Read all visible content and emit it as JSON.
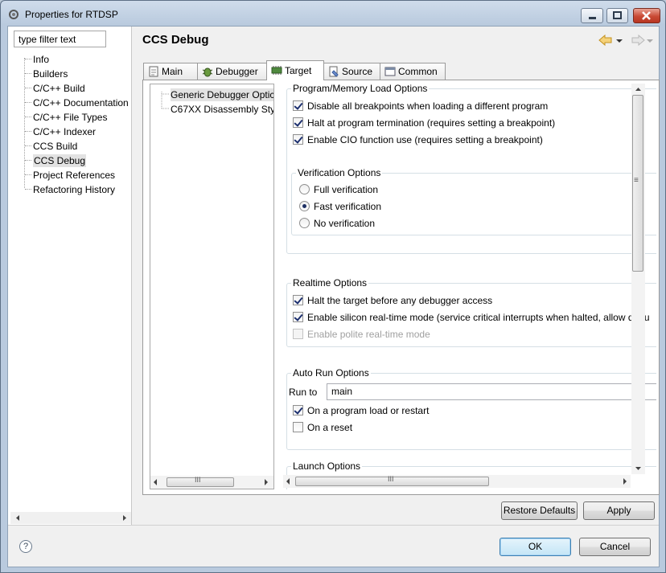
{
  "window": {
    "title": "Properties for RTDSP"
  },
  "left": {
    "filter_placeholder": "type filter text",
    "tree": [
      "Info",
      "Builders",
      "C/C++ Build",
      "C/C++ Documentation",
      "C/C++ File Types",
      "C/C++ Indexer",
      "CCS Build",
      "CCS Debug",
      "Project References",
      "Refactoring History"
    ],
    "selected": "CCS Debug"
  },
  "page": {
    "title": "CCS Debug"
  },
  "tabs": [
    {
      "label": "Main",
      "icon": "page-icon"
    },
    {
      "label": "Debugger",
      "icon": "bug-icon"
    },
    {
      "label": "Target",
      "icon": "chip-icon",
      "active": true
    },
    {
      "label": "Source",
      "icon": "source-icon"
    },
    {
      "label": "Common",
      "icon": "window-icon"
    }
  ],
  "subtree": {
    "items": [
      "Generic Debugger Optic",
      "C67XX Disassembly Styl"
    ]
  },
  "program_load": {
    "title": "Program/Memory Load Options",
    "options": [
      {
        "label": "Disable all breakpoints when loading a different program",
        "checked": true
      },
      {
        "label": "Halt at program termination (requires setting a breakpoint)",
        "checked": true
      },
      {
        "label": "Enable CIO function use (requires setting a breakpoint)",
        "checked": true
      }
    ]
  },
  "verification": {
    "title": "Verification Options",
    "options": [
      {
        "label": "Full verification",
        "selected": false
      },
      {
        "label": "Fast verification",
        "selected": true
      },
      {
        "label": "No verification",
        "selected": false
      }
    ]
  },
  "realtime": {
    "title": "Realtime Options",
    "options": [
      {
        "label": "Halt the target before any debugger access",
        "checked": true,
        "enabled": true
      },
      {
        "label": "Enable silicon real-time mode (service critical interrupts when halted, allow debu",
        "checked": true,
        "enabled": true
      },
      {
        "label": "Enable polite real-time mode",
        "checked": false,
        "enabled": false
      }
    ]
  },
  "autorun": {
    "title": "Auto Run Options",
    "run_to_label": "Run to",
    "run_to_value": "main",
    "options": [
      {
        "label": "On a program load or restart",
        "checked": true
      },
      {
        "label": "On a reset",
        "checked": false
      }
    ]
  },
  "launch": {
    "title": "Launch Options"
  },
  "buttons": {
    "restore_defaults": "Restore Defaults",
    "apply": "Apply",
    "ok": "OK",
    "cancel": "Cancel"
  },
  "scroll": {
    "thumb_glyph": "III",
    "grip_glyph": "≡"
  },
  "help_glyph": "?"
}
